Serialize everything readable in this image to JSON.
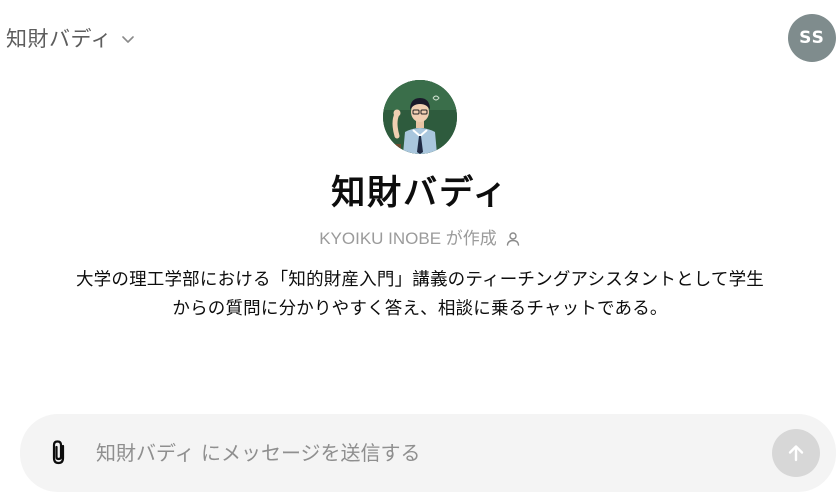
{
  "header": {
    "model_name": "知財バディ",
    "user_initials": "SS"
  },
  "profile": {
    "title": "知財バディ",
    "creator_text": "KYOIKU INOBE が作成",
    "description": "大学の理工学部における「知的財産入門」講義のティーチングアシスタントとして学生からの質問に分かりやすく答え、相談に乗るチャットである。"
  },
  "composer": {
    "placeholder": "知財バディ にメッセージを送信する",
    "value": ""
  },
  "icons": {
    "model_dropdown": "chevron-down-icon",
    "creator": "user-icon",
    "attach": "paperclip-icon",
    "send": "arrow-up-icon"
  },
  "colors": {
    "avatar_bg": "#7f8c8d",
    "composer_bg": "#f4f4f4",
    "send_disabled": "#d7d7d7"
  }
}
